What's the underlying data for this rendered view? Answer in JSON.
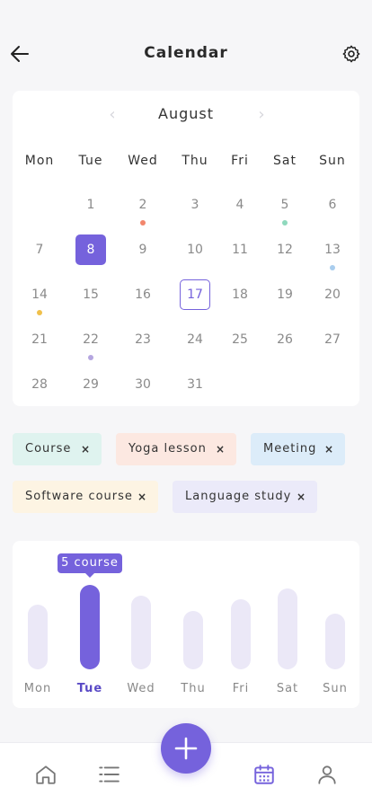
{
  "header": {
    "title": "Calendar",
    "back_icon": "arrow-left-icon",
    "settings_icon": "gear-icon"
  },
  "calendar": {
    "month": "August",
    "weekdays": [
      "Mon",
      "Tue",
      "Wed",
      "Thu",
      "Fri",
      "Sat",
      "Sun"
    ],
    "weeks": [
      [
        "",
        "1",
        "2",
        "3",
        "4",
        "5",
        "6"
      ],
      [
        "7",
        "8",
        "9",
        "10",
        "11",
        "12",
        "13"
      ],
      [
        "14",
        "15",
        "16",
        "17",
        "18",
        "19",
        "20"
      ],
      [
        "21",
        "22",
        "23",
        "24",
        "25",
        "26",
        "27"
      ],
      [
        "28",
        "29",
        "30",
        "31",
        "",
        "",
        ""
      ]
    ],
    "selected_day": "8",
    "today": "17",
    "event_dots": [
      {
        "day": "2",
        "color": "#f2866c"
      },
      {
        "day": "5",
        "color": "#8fd9bd"
      },
      {
        "day": "13",
        "color": "#a9cdee"
      },
      {
        "day": "14",
        "color": "#f0c04b"
      },
      {
        "day": "22",
        "color": "#b5a6e0"
      }
    ]
  },
  "tags": [
    {
      "label": "Course",
      "bg": "#dff3ef"
    },
    {
      "label": "Yoga lesson",
      "bg": "#fce8e1"
    },
    {
      "label": "Meeting",
      "bg": "#dcecf9"
    },
    {
      "label": "Software course",
      "bg": "#fdf4e3"
    },
    {
      "label": "Language study",
      "bg": "#ebeaf9"
    }
  ],
  "tag_remove_symbol": "×",
  "chart_data": {
    "type": "bar",
    "categories": [
      "Mon",
      "Tue",
      "Wed",
      "Thu",
      "Fri",
      "Sat",
      "Sun"
    ],
    "values": [
      72,
      94,
      82,
      65,
      78,
      90,
      62
    ],
    "highlighted": "Tue",
    "tooltip": "5 course",
    "title": "",
    "xlabel": "",
    "ylabel": ""
  },
  "colors": {
    "accent": "#7562dc",
    "bar_inactive": "#ebe8f7"
  },
  "nav": {
    "items": [
      "home-icon",
      "list-icon",
      "calendar-icon",
      "user-icon"
    ],
    "fab_icon": "plus-icon",
    "active": "calendar-icon"
  }
}
